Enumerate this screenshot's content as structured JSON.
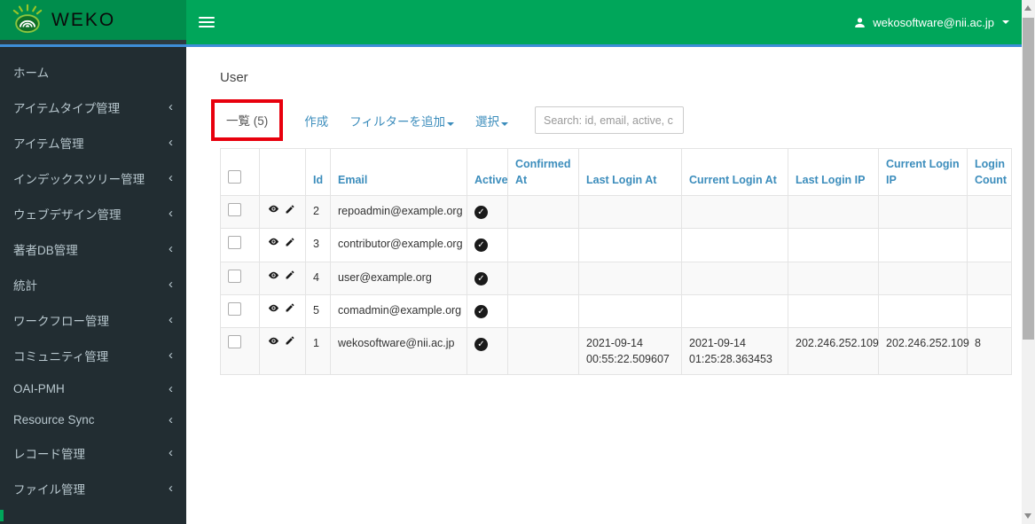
{
  "colors": {
    "navbar_green": "#00a65a",
    "logo_green": "#008d4c",
    "sidebar_dark": "#222d32",
    "link_blue": "#3c8dbc",
    "annotation_red": "#e8000d",
    "divider_blue": "#3e8ed8"
  },
  "topbar": {
    "brand": "WEKO",
    "user_email": "wekosoftware@nii.ac.jp"
  },
  "sidebar": {
    "items": [
      {
        "label": "ホーム"
      },
      {
        "label": "アイテムタイプ管理"
      },
      {
        "label": "アイテム管理"
      },
      {
        "label": "インデックスツリー管理"
      },
      {
        "label": "ウェブデザイン管理"
      },
      {
        "label": "著者DB管理"
      },
      {
        "label": "統計"
      },
      {
        "label": "ワークフロー管理"
      },
      {
        "label": "コミュニティ管理"
      },
      {
        "label": "OAI-PMH"
      },
      {
        "label": "Resource Sync"
      },
      {
        "label": "レコード管理"
      },
      {
        "label": "ファイル管理"
      }
    ]
  },
  "main": {
    "title": "User",
    "toolbar": {
      "list_tab": "一覧 (5)",
      "create_link": "作成",
      "filter_link": "フィルターを追加",
      "select_link": "選択"
    },
    "search": {
      "placeholder": "Search: id, email, active, c"
    },
    "table": {
      "headers": {
        "id": "Id",
        "email": "Email",
        "active": "Active",
        "confirmed_at": "Confirmed At",
        "last_login_at": "Last Login At",
        "current_login_at": "Current Login At",
        "last_login_ip": "Last Login IP",
        "current_login_ip": "Current Login IP",
        "login_count": "Login Count"
      },
      "rows": [
        {
          "id": "2",
          "email": "repoadmin@example.org",
          "active": "yes",
          "confirmed_at": "",
          "last_login_at": "",
          "current_login_at": "",
          "last_login_ip": "",
          "current_login_ip": "",
          "login_count": ""
        },
        {
          "id": "3",
          "email": "contributor@example.org",
          "active": "yes",
          "confirmed_at": "",
          "last_login_at": "",
          "current_login_at": "",
          "last_login_ip": "",
          "current_login_ip": "",
          "login_count": ""
        },
        {
          "id": "4",
          "email": "user@example.org",
          "active": "yes",
          "confirmed_at": "",
          "last_login_at": "",
          "current_login_at": "",
          "last_login_ip": "",
          "current_login_ip": "",
          "login_count": ""
        },
        {
          "id": "5",
          "email": "comadmin@example.org",
          "active": "yes",
          "confirmed_at": "",
          "last_login_at": "",
          "current_login_at": "",
          "last_login_ip": "",
          "current_login_ip": "",
          "login_count": ""
        },
        {
          "id": "1",
          "email": "wekosoftware@nii.ac.jp",
          "active": "yes",
          "confirmed_at": "",
          "last_login_at": "2021-09-14 00:55:22.509607",
          "current_login_at": "2021-09-14 01:25:28.363453",
          "last_login_ip": "202.246.252.109",
          "current_login_ip": "202.246.252.109",
          "login_count": "8"
        }
      ]
    }
  }
}
